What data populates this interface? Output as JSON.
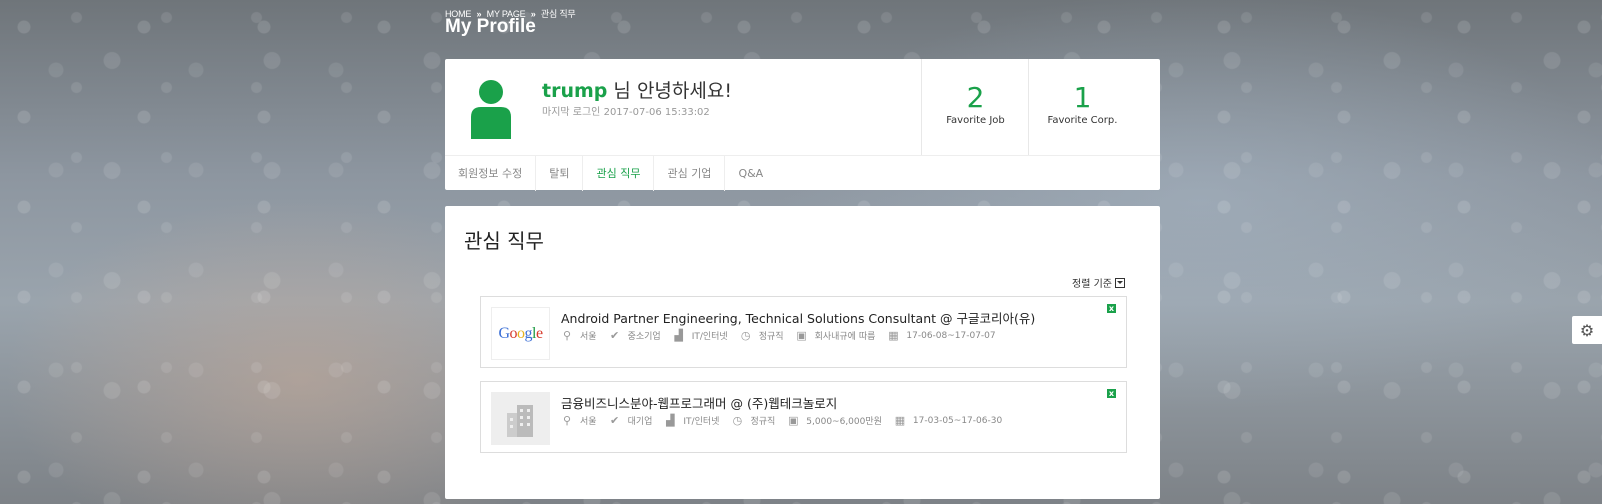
{
  "breadcrumb": {
    "home": "HOME",
    "mypage": "MY PAGE",
    "current": "관심 직무",
    "sep": "»"
  },
  "page_title": "My Profile",
  "profile": {
    "username": "trump",
    "greeting": " 님 안녕하세요!",
    "last_login_label": "마지막 로그인",
    "last_login_time": "2017-07-06 15:33:02",
    "stats": [
      {
        "value": "2",
        "label": "Favorite Job"
      },
      {
        "value": "1",
        "label": "Favorite Corp."
      }
    ]
  },
  "tabs": [
    {
      "label": "회원정보 수정"
    },
    {
      "label": "탈퇴"
    },
    {
      "label": "관심 직무",
      "active": true
    },
    {
      "label": "관심 기업"
    },
    {
      "label": "Q&A"
    }
  ],
  "section": {
    "title": "관심 직무",
    "sort_label": "정렬 기준"
  },
  "jobs": [
    {
      "title": "Android Partner Engineering, Technical Solutions Consultant @ 구글코리아(유)",
      "logo": "Google",
      "location": "서울",
      "company_size": "중소기업",
      "industry": "IT/인터넷",
      "employment": "정규직",
      "salary": "회사내규에 따름",
      "period": "17-06-08~17-07-07",
      "remove_label": "x"
    },
    {
      "title": "금융비즈니스분야-웹프로그래머 @ (주)웹테크놀로지",
      "logo": "building",
      "location": "서울",
      "company_size": "대기업",
      "industry": "IT/인터넷",
      "employment": "정규직",
      "salary": "5,000~6,000만원",
      "period": "17-03-05~17-06-30",
      "remove_label": "x"
    }
  ],
  "colors": {
    "accent": "#1aa14a"
  },
  "icons": [
    "map-marker-icon",
    "check-icon",
    "industry-icon",
    "clock-icon",
    "money-icon",
    "calendar-icon",
    "gear-icon",
    "user-icon"
  ]
}
